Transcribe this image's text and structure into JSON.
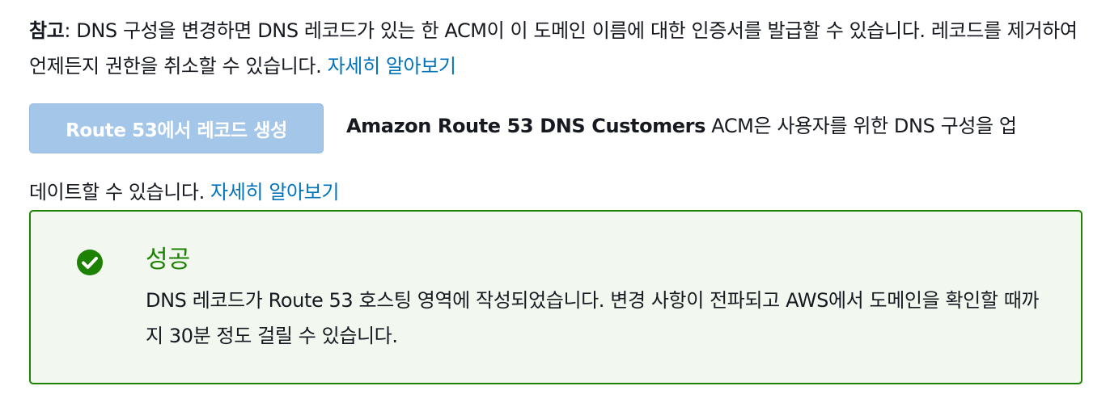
{
  "note": {
    "label": "참고",
    "text": ": DNS 구성을 변경하면 DNS 레코드가 있는 한 ACM이 이 도메인 이름에 대한 인증서를 발급할 수 있습니다. 레코드를 제거하여 언제든지 권한을 취소할 수 있습니다. ",
    "link": "자세히 알아보기"
  },
  "route53": {
    "button_label": "Route 53에서 레코드 생성",
    "bold_text": "Amazon Route 53 DNS Customers",
    "text_line1": " ACM은 사용자를 위한 DNS 구성을 업",
    "text_line2": "데이트할 수 있습니다. ",
    "link": "자세히 알아보기"
  },
  "success": {
    "icon": "check-circle-icon",
    "title": "성공",
    "message": "DNS 레코드가 Route 53 호스팅 영역에 작성되었습니다. 변경 사항이 전파되고 AWS에서 도메인을 확인할 때까지 30분 정도 걸릴 수 있습니다."
  },
  "colors": {
    "link": "#0073bb",
    "button_disabled": "#a4c6e8",
    "success_green": "#1d8102",
    "success_bg": "#f2f8f0"
  }
}
